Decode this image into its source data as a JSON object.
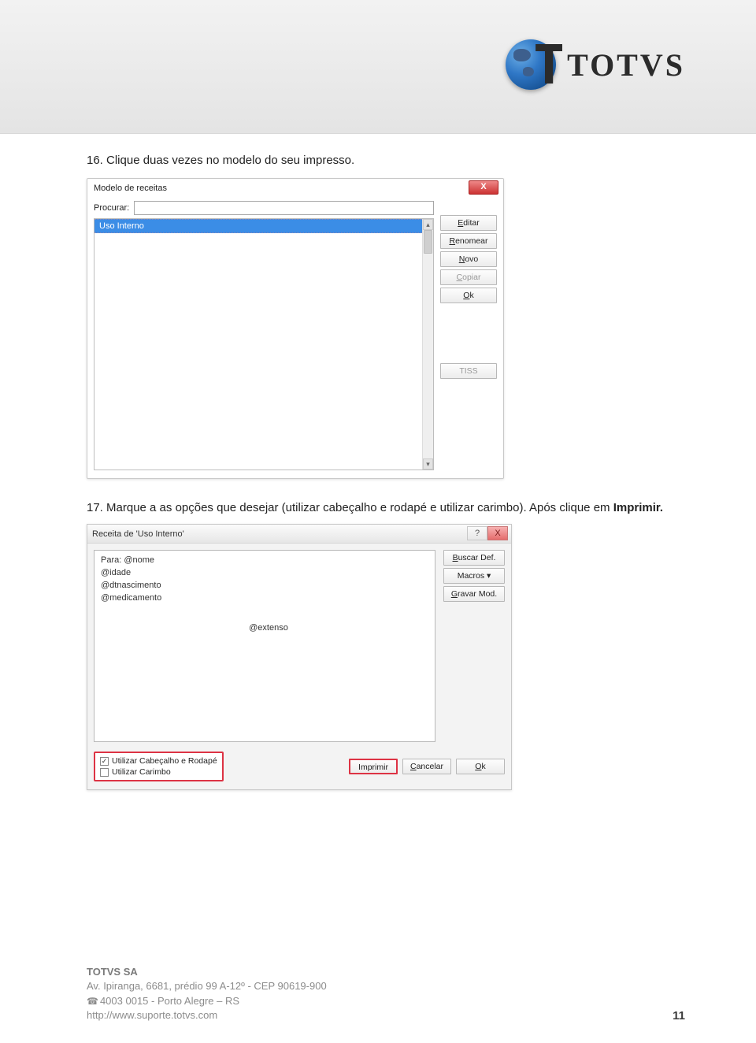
{
  "brand": {
    "name": "TOTVS"
  },
  "steps": {
    "s16": "16. Clique duas vezes no modelo do seu impresso.",
    "s17_a": "17. Marque a as opções que desejar (utilizar cabeçalho e rodapé e utilizar carimbo). Após clique em ",
    "s17_b": "Imprimir."
  },
  "dialog1": {
    "title": "Modelo de receitas",
    "close_x": "X",
    "procurar_label": "Procurar:",
    "procurar_value": "",
    "list": {
      "items": [
        "Uso Interno"
      ]
    },
    "scroll": {
      "up": "▴",
      "down": "▾"
    },
    "buttons": {
      "editar": "Editar",
      "renomear": "Renomear",
      "novo": "Novo",
      "copiar": "Copiar",
      "ok": "Ok",
      "tiss": "TISS"
    }
  },
  "dialog2": {
    "title": "Receita de 'Uso Interno'",
    "help": "?",
    "close_x": "X",
    "editor": {
      "l1": "Para: @nome",
      "l2": "@idade",
      "l3": "@dtnascimento",
      "l4": "@medicamento",
      "center": "@extenso"
    },
    "rbuttons": {
      "buscar": "Buscar Def.",
      "macros": "Macros ▾",
      "gravar": "Gravar Mod."
    },
    "checks": {
      "cb1_checked": "✓",
      "cb1_label": "Utilizar Cabeçalho e Rodapé",
      "cb2_checked": "",
      "cb2_label": "Utilizar Carimbo"
    },
    "actions": {
      "imprimir": "Imprimir",
      "cancelar": "Cancelar",
      "ok": "Ok"
    }
  },
  "footer": {
    "company": "TOTVS SA",
    "address": "Av. Ipiranga, 6681, prédio 99 A-12º - CEP 90619-900",
    "phone": "4003 0015 - Porto Alegre – RS",
    "url": "http://www.suporte.totvs.com",
    "page": "11"
  }
}
